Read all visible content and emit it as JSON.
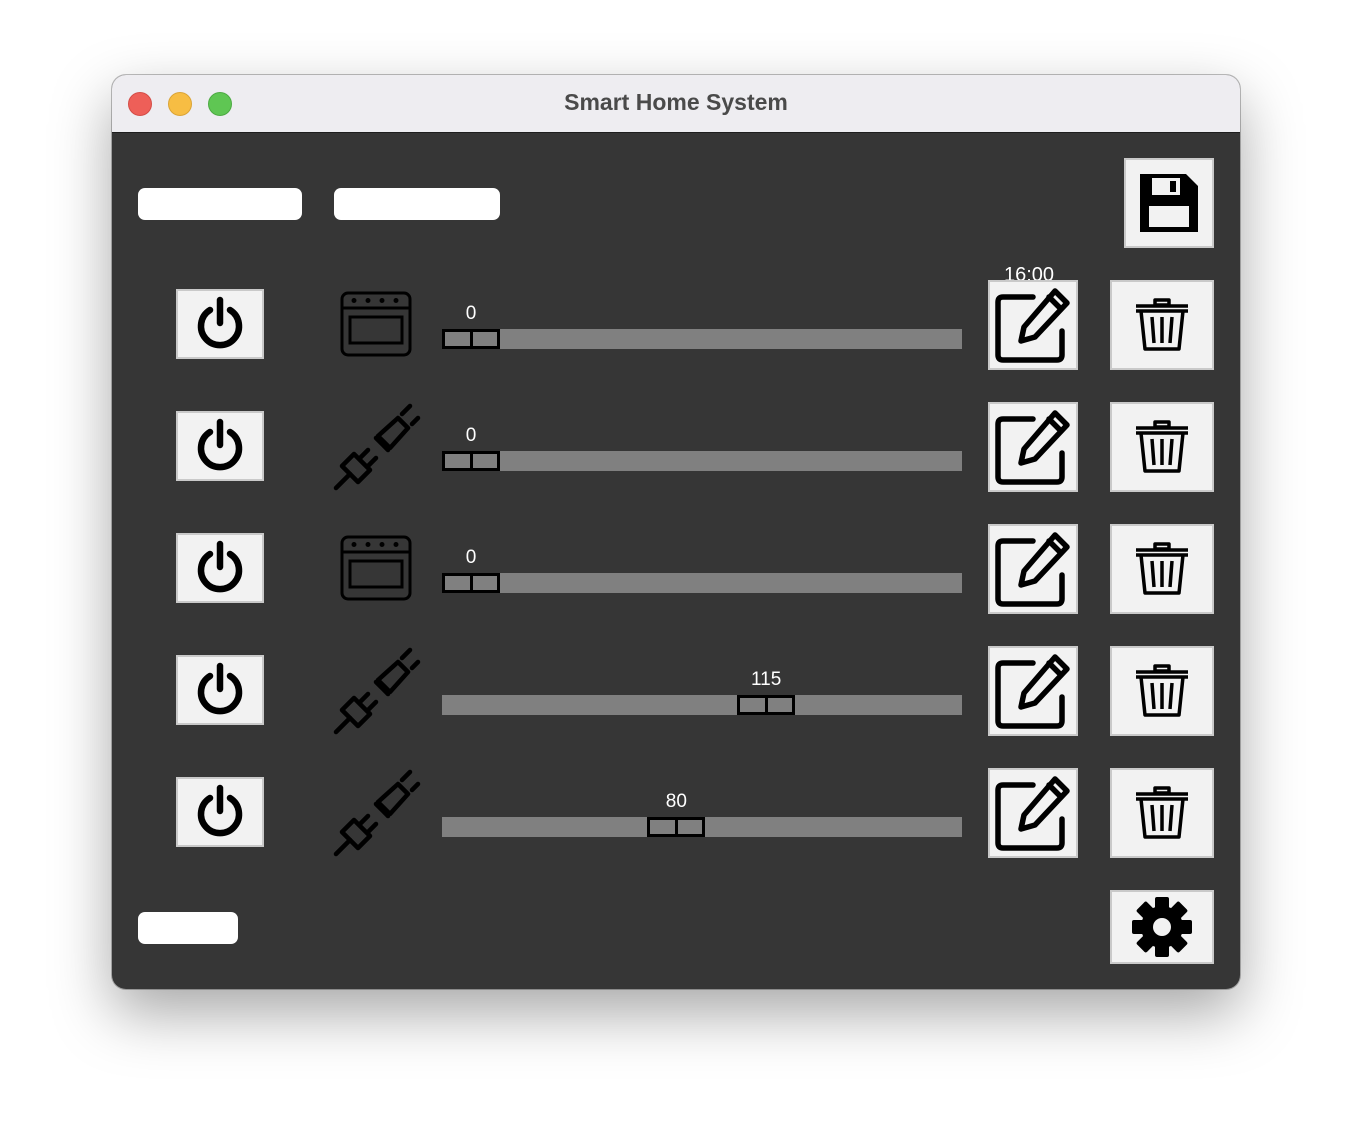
{
  "window": {
    "title": "Smart Home System"
  },
  "header": {
    "time": "16:00"
  },
  "devices": [
    {
      "type": "oven",
      "icon": "oven-icon",
      "value": 0,
      "min": 0,
      "max": 180,
      "label": "0"
    },
    {
      "type": "plug",
      "icon": "plug-icon",
      "value": 0,
      "min": 0,
      "max": 180,
      "label": "0"
    },
    {
      "type": "oven",
      "icon": "oven-icon",
      "value": 0,
      "min": 0,
      "max": 180,
      "label": "0"
    },
    {
      "type": "plug",
      "icon": "plug-icon",
      "value": 115,
      "min": 0,
      "max": 180,
      "label": "115"
    },
    {
      "type": "plug",
      "icon": "plug-icon",
      "value": 80,
      "min": 0,
      "max": 180,
      "label": "80"
    }
  ],
  "icons": {
    "save": "floppy-disk-icon",
    "power": "power-icon",
    "edit": "edit-icon",
    "delete": "trash-icon",
    "settings": "gear-icon"
  },
  "colors": {
    "background": "#363636",
    "track": "#808080",
    "button": "#f2f2f2",
    "titlebar": "#eeedf1"
  }
}
